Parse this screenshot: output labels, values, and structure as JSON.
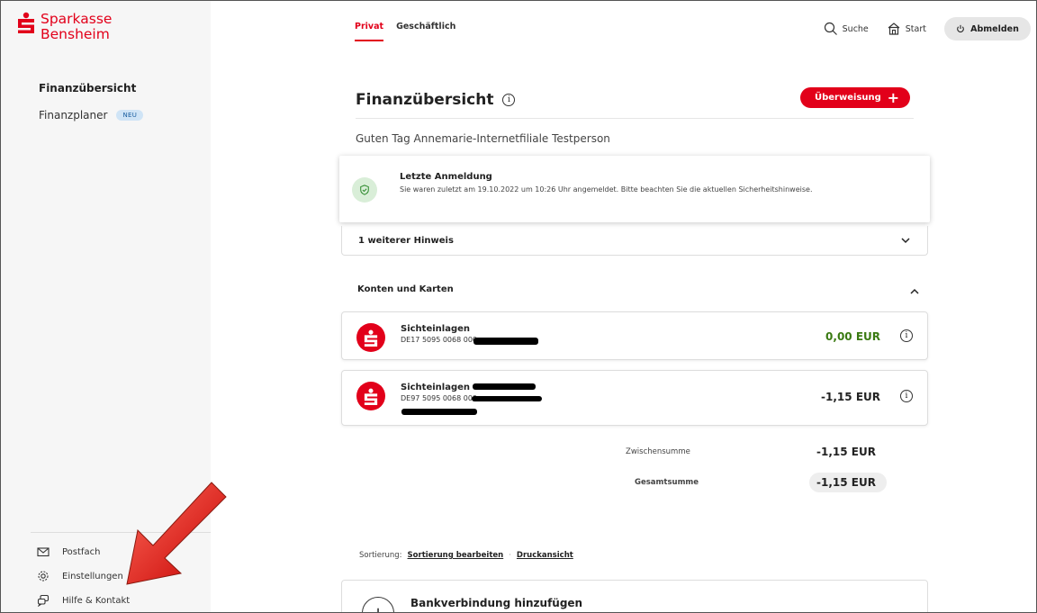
{
  "brand": {
    "line1": "Sparkasse",
    "line2": "Bensheim",
    "color": "#e2001a"
  },
  "sidebar": {
    "items": [
      {
        "label": "Finanzübersicht",
        "active": true
      },
      {
        "label": "Finanzplaner",
        "badge": "NEU"
      }
    ],
    "bottom_links": [
      {
        "label": "Postfach",
        "icon": "mail-icon"
      },
      {
        "label": "Einstellungen",
        "icon": "gear-icon"
      },
      {
        "label": "Hilfe & Kontakt",
        "icon": "chat-icon"
      }
    ]
  },
  "topnav": {
    "tabs": [
      {
        "label": "Privat",
        "active": true
      },
      {
        "label": "Geschäftlich"
      }
    ],
    "search_label": "Suche",
    "start_label": "Start",
    "logout_label": "Abmelden"
  },
  "main": {
    "title": "Finanzübersicht",
    "transfer_button": "Überweisung",
    "greeting": "Guten Tag Annemarie-Internetfiliale Testperson",
    "notice": {
      "title": "Letzte Anmeldung",
      "text": "Sie waren zuletzt am 19.10.2022 um 10:26 Uhr angemeldet. Bitte beachten Sie die aktuellen Sicherheitshinweise."
    },
    "more_hints": "1 weiterer Hinweis",
    "accounts_section": "Konten und Karten",
    "accounts": [
      {
        "name": "Sichteinlagen",
        "iban": "DE17 5095 0068 000",
        "amount": "0,00 EUR",
        "amount_color": "#3a7a12"
      },
      {
        "name": "Sichteinlagen -",
        "iban": "DE97 5095 0068 000",
        "amount": "-1,15 EUR"
      }
    ],
    "subtotal_label": "Zwischensumme",
    "subtotal_value": "-1,15 EUR",
    "total_label": "Gesamtsumme",
    "total_value": "-1,15 EUR",
    "sort_label": "Sortierung:",
    "sort_edit": "Sortierung bearbeiten",
    "print_view": "Druckansicht",
    "add_bank": "Bankverbindung hinzufügen"
  }
}
